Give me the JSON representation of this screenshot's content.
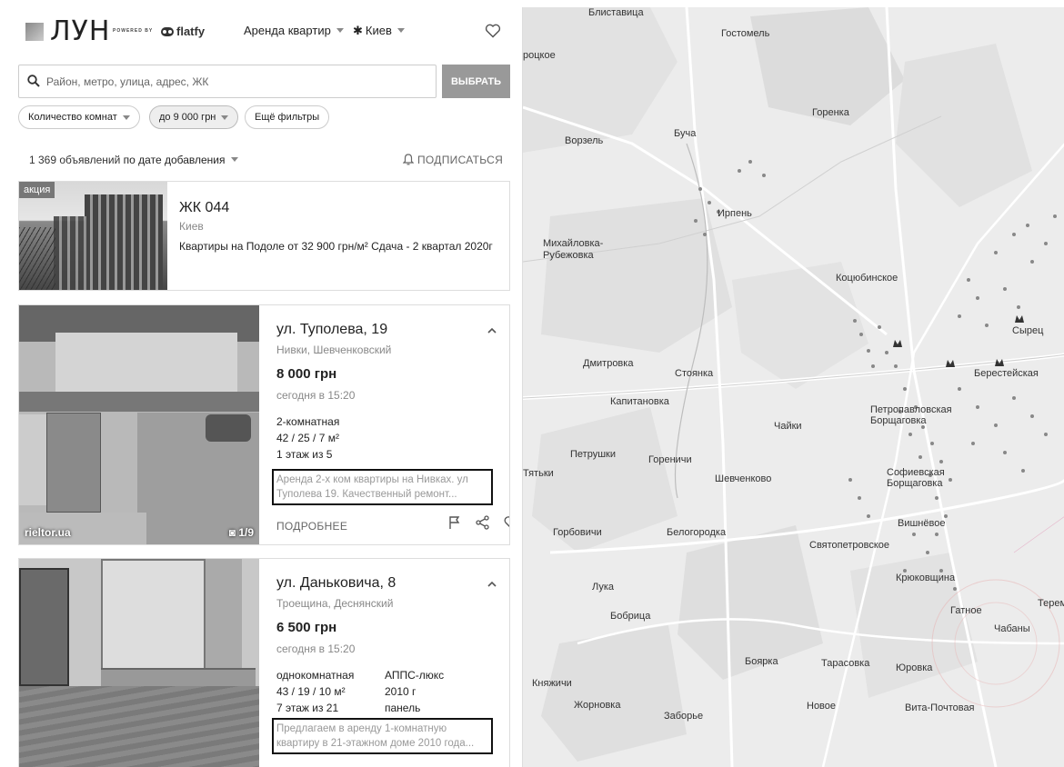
{
  "header": {
    "logo": "ЛУН",
    "powered_by": "POWERED BY",
    "partner": "flatfy",
    "deal_type": "Аренда квартир",
    "city": "Киев"
  },
  "search": {
    "placeholder": "Район, метро, улица, адрес, ЖК",
    "button": "ВЫБРАТЬ"
  },
  "filters": [
    {
      "label": "Количество комнат",
      "active": false
    },
    {
      "label": "до 9 000 грн",
      "active": true
    },
    {
      "label": "Ещё фильтры",
      "active": false
    }
  ],
  "results": {
    "count": "1 369 объявлений",
    "sort": "по дате добавления",
    "subscribe": "ПОДПИСАТЬСЯ"
  },
  "promo": {
    "badge": "акция",
    "title": "ЖК 044",
    "city": "Киев",
    "description": "Квартиры на Подоле от 32 900 грн/м² Сдача - 2 квартал 2020г"
  },
  "listings": [
    {
      "address": "ул. Туполева, 19",
      "district": "Нивки, Шевченковский",
      "price": "8 000 грн",
      "date": "сегодня в 15:20",
      "rooms": "2-комнатная",
      "area": "42 / 25 / 7 м²",
      "floor": "1 этаж из 5",
      "description": "Аренда 2-х ком квартиры на Нивках. ул Туполева 19. Качественный ремонт...",
      "more": "ПОДРОБНЕЕ",
      "source": "rieltor.ua",
      "photos": "1/9"
    },
    {
      "address": "ул. Даньковича, 8",
      "district": "Троещина, Деснянский",
      "price": "6 500 грн",
      "date": "сегодня в 15:20",
      "rooms": "однокомнатная",
      "area": "43 / 19 / 10 м²",
      "floor": "7 этаж из 21",
      "extra1": "АППС-люкс",
      "extra2": "2010 г",
      "extra3": "панель",
      "description": "Предлагаем в аренду 1-комнатную квартиру в 21-этажном доме 2010 года..."
    }
  ],
  "map": {
    "places": [
      "Блиставица",
      "Гостомель",
      "роцкое",
      "Горенка",
      "Ворзель",
      "Буча",
      "Ирпень",
      "Михайловка-Рубежовка",
      "Коцюбинское",
      "Сырец",
      "Дмитровка",
      "Стоянка",
      "Берестейская",
      "Капитановка",
      "Чайки",
      "Петропавловская Борщаговка",
      "Петрушки",
      "Гореничи",
      "Шевченково",
      "Софиевская Борщаговка",
      "Тятьки",
      "Горбовичи",
      "Белогородка",
      "Святопетровское",
      "Вишнёвое",
      "Лука",
      "Крюковщина",
      "Бобрица",
      "Гатное",
      "Чабаны",
      "Боярка",
      "Тарасовка",
      "Юровка",
      "Княжичи",
      "Жорновка",
      "Новое",
      "Вита-Почтовая",
      "Заборье",
      "Терем"
    ]
  }
}
